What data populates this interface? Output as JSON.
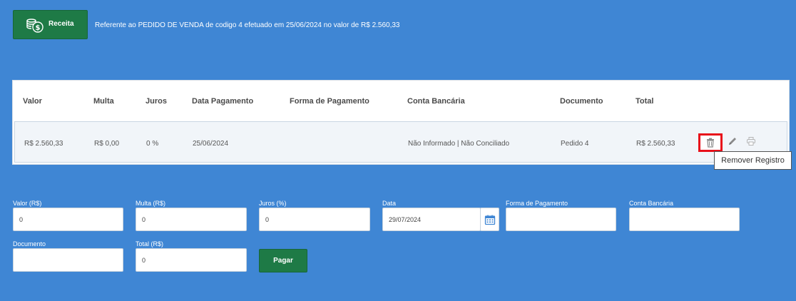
{
  "header": {
    "receita_label": "Receita",
    "description": "Referente ao PEDIDO DE VENDA de codigo 4 efetuado em 25/06/2024 no valor de R$ 2.560,33"
  },
  "table": {
    "columns": [
      "Valor",
      "Multa",
      "Juros",
      "Data Pagamento",
      "Forma de Pagamento",
      "Conta Bancária",
      "Documento",
      "Total"
    ],
    "rows": [
      {
        "valor": "R$ 2.560,33",
        "multa": "R$ 0,00",
        "juros": "0 %",
        "data_pagamento": "25/06/2024",
        "forma_pagamento": "",
        "conta_bancaria": "Não Informado | Não Conciliado",
        "documento": "Pedido 4",
        "total": "R$ 2.560,33"
      }
    ],
    "tooltip": "Remover Registro"
  },
  "form": {
    "valor": {
      "label": "Valor (R$)",
      "value": "0"
    },
    "multa": {
      "label": "Multa (R$)",
      "value": "0"
    },
    "juros": {
      "label": "Juros (%)",
      "value": "0"
    },
    "data": {
      "label": "Data",
      "value": "29/07/2024"
    },
    "forma_pagamento": {
      "label": "Forma de Pagamento",
      "value": ""
    },
    "conta_bancaria": {
      "label": "Conta Bancária",
      "value": ""
    },
    "documento": {
      "label": "Documento",
      "value": ""
    },
    "total": {
      "label": "Total (R$)",
      "value": "0"
    },
    "pagar_label": "Pagar"
  },
  "colors": {
    "background": "#3f86d4",
    "button_green": "#1e7a46",
    "highlight_red": "#e8101a"
  },
  "icons": [
    "money-icon",
    "trash-icon",
    "edit-icon",
    "print-icon",
    "calendar-icon"
  ]
}
